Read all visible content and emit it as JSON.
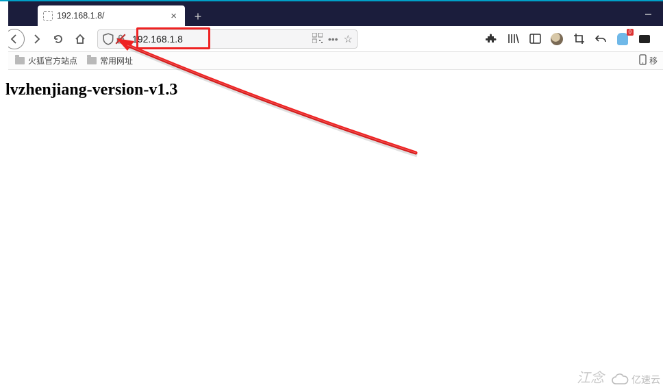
{
  "tab": {
    "title": "192.168.1.8/"
  },
  "url": {
    "value": "192.168.1.8"
  },
  "bookmarks": {
    "b1": "火狐官方站点",
    "b2": "常用网址",
    "mobile_suffix": "移"
  },
  "page": {
    "heading": "lvzhenjiang-version-v1.3"
  },
  "ext_badge": "0",
  "watermark": "江念",
  "cloud": "亿速云"
}
